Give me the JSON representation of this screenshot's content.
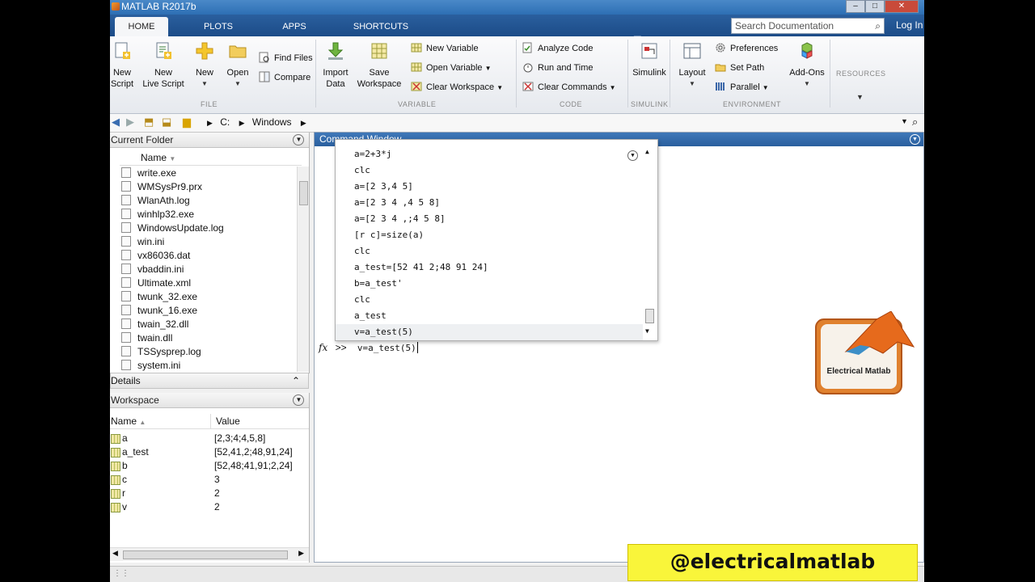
{
  "window": {
    "title": "MATLAB R2017b"
  },
  "tabs": [
    "HOME",
    "PLOTS",
    "APPS",
    "SHORTCUTS"
  ],
  "search": {
    "placeholder": "Search Documentation"
  },
  "login": "Log In",
  "ribbon": {
    "file": {
      "group": "FILE",
      "new_script": [
        "New",
        "Script"
      ],
      "new_live_script": [
        "New",
        "Live Script"
      ],
      "new": "New",
      "open": "Open",
      "find_files": "Find Files",
      "compare": "Compare"
    },
    "variable": {
      "group": "VARIABLE",
      "import_data": [
        "Import",
        "Data"
      ],
      "save_workspace": [
        "Save",
        "Workspace"
      ],
      "new_variable": "New Variable",
      "open_variable": "Open Variable",
      "clear_workspace": "Clear Workspace"
    },
    "code": {
      "group": "CODE",
      "analyze_code": "Analyze Code",
      "run_and_time": "Run and Time",
      "clear_commands": "Clear Commands"
    },
    "simulink": {
      "group": "SIMULINK",
      "simulink": "Simulink"
    },
    "environment": {
      "group": "ENVIRONMENT",
      "layout": "Layout",
      "preferences": "Preferences",
      "set_path": "Set Path",
      "parallel": "Parallel",
      "addons": "Add-Ons"
    },
    "resources": {
      "group": "RESOURCES"
    }
  },
  "address": {
    "path": [
      "C:",
      "Windows"
    ]
  },
  "current_folder": {
    "title": "Current Folder",
    "column": "Name",
    "files": [
      "write.exe",
      "WMSysPr9.prx",
      "WlanAth.log",
      "winhlp32.exe",
      "WindowsUpdate.log",
      "win.ini",
      "vx86036.dat",
      "vbaddin.ini",
      "Ultimate.xml",
      "twunk_32.exe",
      "twunk_16.exe",
      "twain_32.dll",
      "twain.dll",
      "TSSysprep.log",
      "system.ini"
    ]
  },
  "details": {
    "title": "Details"
  },
  "workspace": {
    "title": "Workspace",
    "columns": [
      "Name",
      "Value"
    ],
    "rows": [
      {
        "name": "a",
        "value": "[2,3;4;4,5,8]"
      },
      {
        "name": "a_test",
        "value": "[52,41,2;48,91,24]"
      },
      {
        "name": "b",
        "value": "[52,48;41,91;2,24]"
      },
      {
        "name": "c",
        "value": "3"
      },
      {
        "name": "r",
        "value": "2"
      },
      {
        "name": "v",
        "value": "2"
      }
    ]
  },
  "command_window": {
    "title": "Command Window",
    "history": [
      "a=2+3*j",
      "clc",
      "a=[2 3,4 5]",
      "a=[2 3 4 ,4 5 8]",
      "a=[2 3 4 ,;4 5 8]",
      "[r c]=size(a)",
      "clc",
      "a_test=[52 41 2;48 91 24]",
      "b=a_test'",
      "clc",
      "a_test",
      "v=a_test(5)"
    ],
    "prompt_symbol": ">>",
    "current_input": "v=a_test(5)"
  },
  "logo_text": "Electrical Matlab",
  "watermark": "@electricalmatlab"
}
